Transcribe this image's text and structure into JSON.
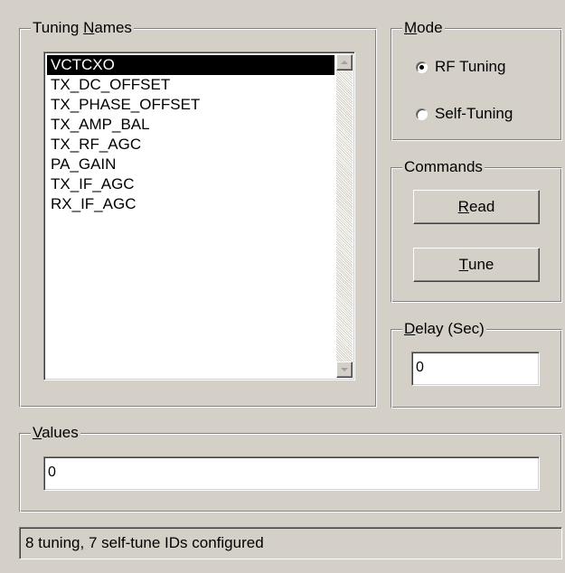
{
  "tuning_names": {
    "legend_mnemonic": "N",
    "legend_before": "Tuning ",
    "legend_after": "ames",
    "items": [
      "VCTCXO",
      "TX_DC_OFFSET",
      "TX_PHASE_OFFSET",
      "TX_AMP_BAL",
      "TX_RF_AGC",
      "PA_GAIN",
      "TX_IF_AGC",
      "RX_IF_AGC"
    ],
    "selected_index": 0
  },
  "mode": {
    "legend_mnemonic": "M",
    "legend_after": "ode",
    "options": [
      {
        "label": "RF Tuning",
        "checked": true
      },
      {
        "label": "Self-Tuning",
        "checked": false
      }
    ]
  },
  "commands": {
    "legend": "Commands",
    "read_mnemonic": "R",
    "read_rest": "ead",
    "tune_mnemonic": "T",
    "tune_rest": "une"
  },
  "delay": {
    "legend_mnemonic": "D",
    "legend_after": "elay (Sec)",
    "value": "0"
  },
  "values": {
    "legend_mnemonic": "V",
    "legend_after": "alues",
    "value": "0"
  },
  "status": {
    "text": "8 tuning, 7 self-tune IDs configured"
  }
}
